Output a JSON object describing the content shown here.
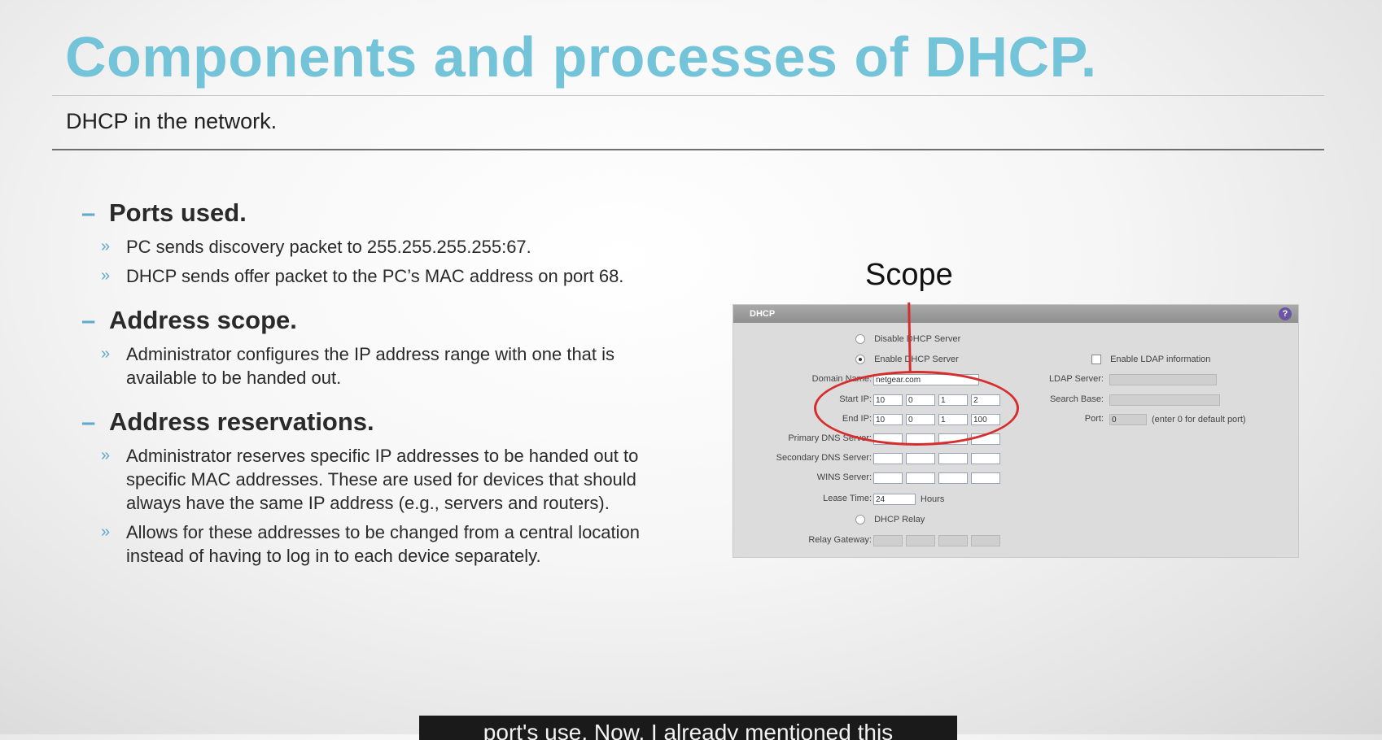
{
  "slide": {
    "title": "Components and processes of DHCP.",
    "subtitle": "DHCP in the network."
  },
  "sections": [
    {
      "heading": "Ports used.",
      "bullets": [
        "PC sends discovery packet to 255.255.255.255:67.",
        "DHCP sends offer packet to the PC’s MAC address on port 68."
      ]
    },
    {
      "heading": "Address scope.",
      "bullets": [
        "Administrator configures the IP address range with one that is available to be handed out."
      ]
    },
    {
      "heading": "Address reservations.",
      "bullets": [
        "Administrator reserves specific IP addresses to be handed out to specific MAC addresses. These are used for devices that should always have the same IP address (e.g., servers and routers).",
        "Allows for these addresses to be changed from a central location instead of having to log in to each device separately."
      ]
    }
  ],
  "symbols": {
    "dash": "–",
    "chevron": "»"
  },
  "scope_label": "Scope",
  "dhcp_panel": {
    "header": "DHCP",
    "help_glyph": "?",
    "disable_label": "Disable DHCP Server",
    "enable_label": "Enable DHCP Server",
    "domain_name_label": "Domain Name:",
    "domain_name_value": "netgear.com",
    "start_ip_label": "Start IP:",
    "start_ip": [
      "10",
      "0",
      "1",
      "2"
    ],
    "end_ip_label": "End IP:",
    "end_ip": [
      "10",
      "0",
      "1",
      "100"
    ],
    "primary_dns_label": "Primary DNS Server:",
    "secondary_dns_label": "Secondary DNS Server:",
    "wins_label": "WINS Server:",
    "lease_time_label": "Lease Time:",
    "lease_time_value": "24",
    "lease_time_unit": "Hours",
    "dhcp_relay_label": "DHCP Relay",
    "relay_gateway_label": "Relay Gateway:",
    "ldap_enable_label": "Enable LDAP information",
    "ldap_server_label": "LDAP Server:",
    "search_base_label": "Search Base:",
    "port_label": "Port:",
    "port_value": "0",
    "port_hint": "(enter 0 for default port)"
  },
  "caption": "port's use. Now, I already mentioned this",
  "colors": {
    "title": "#73c3d9",
    "bullet_accent": "#5ea9cc",
    "highlight": "#d62d2d"
  }
}
